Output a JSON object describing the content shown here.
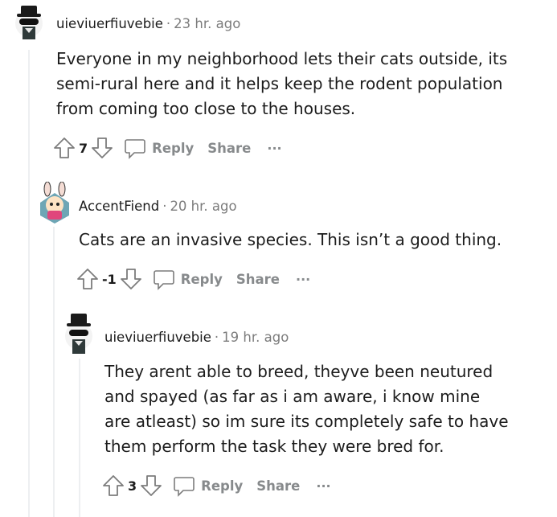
{
  "comments": [
    {
      "author": "uieviuerfiuvebie",
      "separator": "·",
      "time": "23 hr. ago",
      "body_lines": [
        "Everyone in my neighborhood lets their cats outside, its",
        "semi-rural here and it helps keep the rodent population",
        "from coming too close to the houses."
      ],
      "score": "7",
      "reply_label": "Reply",
      "share_label": "Share",
      "more_label": "···"
    },
    {
      "author": "AccentFiend",
      "separator": "·",
      "time": "20 hr. ago",
      "body_lines": [
        "Cats are an invasive species. This isn’t a good thing."
      ],
      "score": "-1",
      "reply_label": "Reply",
      "share_label": "Share",
      "more_label": "···"
    },
    {
      "author": "uieviuerfiuvebie",
      "separator": "·",
      "time": "19 hr. ago",
      "body_lines": [
        "They arent able to breed, theyve been neutured",
        "and spayed (as far as i am aware, i know mine",
        "are atleast) so im sure its completely safe to have",
        "them perform the task they were bred for."
      ],
      "score": "3",
      "reply_label": "Reply",
      "share_label": "Share",
      "more_label": "···"
    }
  ],
  "colors": {
    "text": "#1c1c1c",
    "meta": "#7c7c7c",
    "action": "#878a8c",
    "thread_line": "#edeff1"
  },
  "icons": [
    "snoo-tophat-avatar",
    "snoo-bunny-avatar",
    "upvote-icon",
    "downvote-icon",
    "comment-bubble-icon",
    "more-icon"
  ]
}
